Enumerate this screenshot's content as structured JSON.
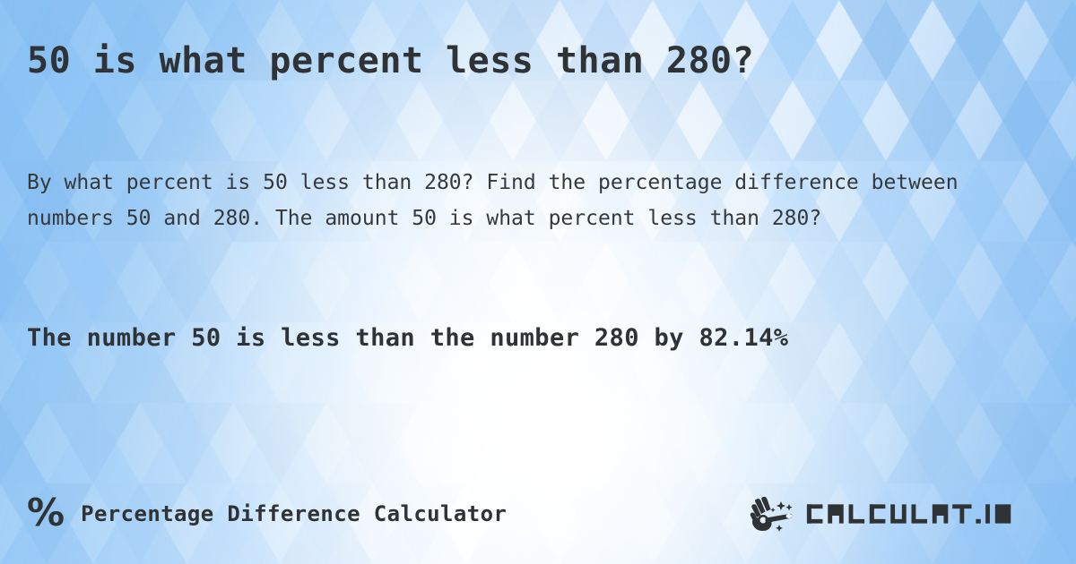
{
  "page": {
    "headline": "50 is what percent less than 280?",
    "intro": "By what percent is 50 less than 280? Find the percentage difference between numbers 50 and 280. The amount 50 is what percent less than 280?",
    "answer": "The number 50 is less than the number 280 by 82.14%"
  },
  "values": {
    "smaller_number": "50",
    "larger_number": "280",
    "percent_less": "82.14%"
  },
  "footer": {
    "percent_icon": "%",
    "tool_name": "Percentage Difference Calculator",
    "logo_text": "CALCULAT.IO",
    "wand_icon": "hand-magic-wand-icon"
  },
  "colors": {
    "text_dark": "#2f3335",
    "text_body": "#36393b",
    "background_blue": "#bfdcfa",
    "background_blue_deep": "#8cc2f4",
    "background_light": "#ffffff"
  }
}
